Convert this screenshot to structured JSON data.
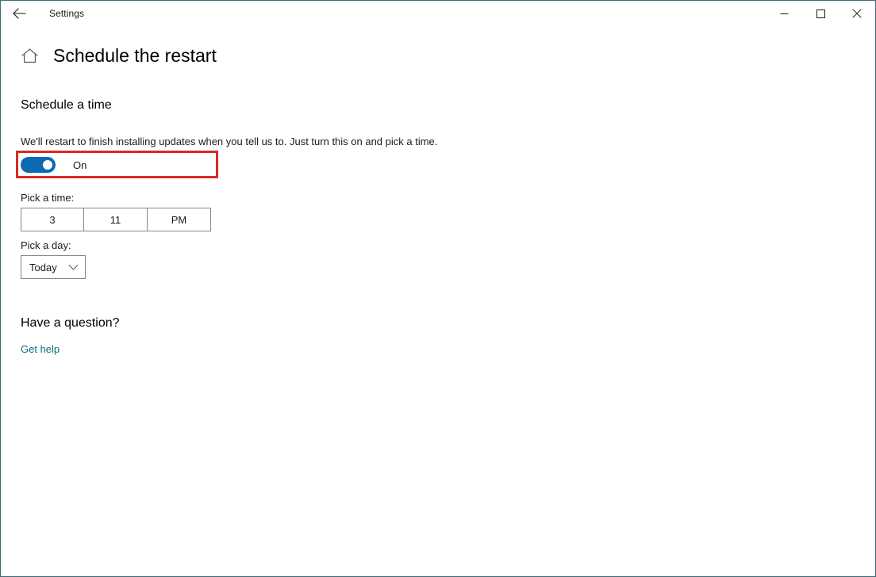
{
  "window": {
    "app_title": "Settings",
    "border_color": "#3d6b77",
    "back_icon": "back-arrow-icon",
    "caption": {
      "minimize": "minimize-icon",
      "maximize": "maximize-icon",
      "close": "close-icon"
    }
  },
  "page": {
    "home_icon": "home-icon",
    "title": "Schedule the restart"
  },
  "schedule": {
    "heading": "Schedule a time",
    "description": "We'll restart to finish installing updates when you tell us to. Just turn this on and pick a time.",
    "toggle": {
      "state_label": "On",
      "is_on": true,
      "accent_color": "#0b6ab2",
      "highlight_color": "#d42b26"
    },
    "time": {
      "label": "Pick a time:",
      "hour": "3",
      "minute": "11",
      "period": "PM"
    },
    "day": {
      "label": "Pick a day:",
      "selected": "Today",
      "chevron_icon": "chevron-down-icon"
    }
  },
  "help": {
    "heading": "Have a question?",
    "link_label": "Get help",
    "link_color": "#0e6c84"
  }
}
